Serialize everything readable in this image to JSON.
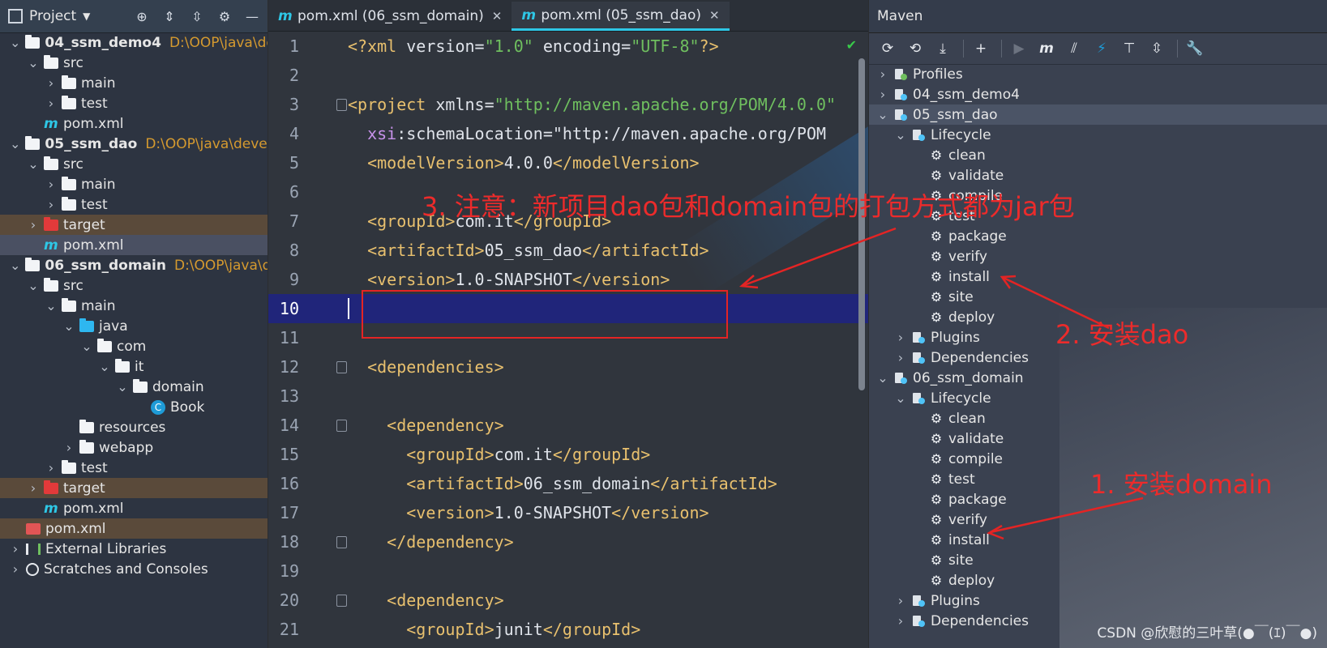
{
  "project_panel": {
    "title": "Project",
    "tree": [
      {
        "label": "04_ssm_demo4",
        "path": "D:\\OOP\\java\\deve",
        "indent": 0,
        "expanded": true,
        "icon": "module-folder-icon",
        "bold": true
      },
      {
        "label": "src",
        "indent": 1,
        "expanded": true,
        "icon": "folder-icon"
      },
      {
        "label": "main",
        "indent": 2,
        "expanded": false,
        "icon": "folder-icon"
      },
      {
        "label": "test",
        "indent": 2,
        "expanded": false,
        "icon": "folder-icon"
      },
      {
        "label": "pom.xml",
        "indent": 1,
        "icon": "maven-icon"
      },
      {
        "label": "05_ssm_dao",
        "path": "D:\\OOP\\java\\develop_",
        "indent": 0,
        "expanded": true,
        "icon": "module-folder-icon",
        "bold": true
      },
      {
        "label": "src",
        "indent": 1,
        "expanded": true,
        "icon": "folder-icon"
      },
      {
        "label": "main",
        "indent": 2,
        "expanded": false,
        "icon": "folder-icon"
      },
      {
        "label": "test",
        "indent": 2,
        "expanded": false,
        "icon": "folder-icon"
      },
      {
        "label": "target",
        "indent": 1,
        "expanded": false,
        "icon": "excluded-folder-icon",
        "state": "excluded"
      },
      {
        "label": "pom.xml",
        "indent": 1,
        "icon": "maven-icon",
        "state": "selected"
      },
      {
        "label": "06_ssm_domain",
        "path": "D:\\OOP\\java\\deve",
        "indent": 0,
        "expanded": true,
        "icon": "module-folder-icon",
        "bold": true
      },
      {
        "label": "src",
        "indent": 1,
        "expanded": true,
        "icon": "folder-icon"
      },
      {
        "label": "main",
        "indent": 2,
        "expanded": true,
        "icon": "folder-icon"
      },
      {
        "label": "java",
        "indent": 3,
        "expanded": true,
        "icon": "source-folder-icon"
      },
      {
        "label": "com",
        "indent": 4,
        "expanded": true,
        "icon": "package-icon"
      },
      {
        "label": "it",
        "indent": 5,
        "expanded": true,
        "icon": "package-icon"
      },
      {
        "label": "domain",
        "indent": 6,
        "expanded": true,
        "icon": "package-icon"
      },
      {
        "label": "Book",
        "indent": 7,
        "icon": "class-icon"
      },
      {
        "label": "resources",
        "indent": 3,
        "icon": "resources-folder-icon"
      },
      {
        "label": "webapp",
        "indent": 3,
        "expanded": false,
        "icon": "web-folder-icon"
      },
      {
        "label": "test",
        "indent": 2,
        "expanded": false,
        "icon": "folder-icon"
      },
      {
        "label": "target",
        "indent": 1,
        "expanded": false,
        "icon": "excluded-folder-icon",
        "state": "excluded"
      },
      {
        "label": "pom.xml",
        "indent": 1,
        "icon": "maven-icon"
      },
      {
        "label": "pom.xml",
        "indent": 0,
        "icon": "xml-file-icon",
        "state": "excluded"
      },
      {
        "label": "External Libraries",
        "indent": 0,
        "expanded": false,
        "icon": "libraries-icon"
      },
      {
        "label": "Scratches and Consoles",
        "indent": 0,
        "expanded": false,
        "icon": "scratches-icon"
      }
    ]
  },
  "editor": {
    "tabs": [
      {
        "label": "pom.xml (06_ssm_domain)",
        "active": false
      },
      {
        "label": "pom.xml (05_ssm_dao)",
        "active": true
      }
    ],
    "current_line": 10,
    "lines": [
      {
        "n": "1",
        "text": "<?xml version=\"1.0\" encoding=\"UTF-8\"?>"
      },
      {
        "n": "2",
        "text": ""
      },
      {
        "n": "3",
        "text": "<project xmlns=\"http://maven.apache.org/POM/4.0.0\"",
        "fold": true
      },
      {
        "n": "4",
        "text": "  xsi:schemaLocation=\"http://maven.apache.org/POM"
      },
      {
        "n": "5",
        "text": "  <modelVersion>4.0.0</modelVersion>"
      },
      {
        "n": "6",
        "text": ""
      },
      {
        "n": "7",
        "text": "  <groupId>com.it</groupId>"
      },
      {
        "n": "8",
        "text": "  <artifactId>05_ssm_dao</artifactId>"
      },
      {
        "n": "9",
        "text": "  <version>1.0-SNAPSHOT</version>"
      },
      {
        "n": "10",
        "text": ""
      },
      {
        "n": "11",
        "text": ""
      },
      {
        "n": "12",
        "text": "  <dependencies>",
        "fold": true
      },
      {
        "n": "13",
        "text": ""
      },
      {
        "n": "14",
        "text": "    <dependency>",
        "fold": true
      },
      {
        "n": "15",
        "text": "      <groupId>com.it</groupId>"
      },
      {
        "n": "16",
        "text": "      <artifactId>06_ssm_domain</artifactId>"
      },
      {
        "n": "17",
        "text": "      <version>1.0-SNAPSHOT</version>"
      },
      {
        "n": "18",
        "text": "    </dependency>",
        "fold": true
      },
      {
        "n": "19",
        "text": ""
      },
      {
        "n": "20",
        "text": "    <dependency>",
        "fold": true
      },
      {
        "n": "21",
        "text": "      <groupId>junit</groupId>"
      }
    ]
  },
  "maven_panel": {
    "title": "Maven",
    "toolbar": [
      "reload-icon",
      "generate-sources-icon",
      "download-icon",
      "add-icon",
      "run-icon",
      "maven-goal-icon",
      "toggle-offline-icon",
      "skip-tests-icon",
      "show-dependencies-icon",
      "collapse-all-icon",
      "settings-wrench-icon"
    ],
    "tree": [
      {
        "label": "Profiles",
        "indent": 0,
        "expanded": false,
        "icon": "profiles-icon"
      },
      {
        "label": "04_ssm_demo4",
        "indent": 0,
        "expanded": false,
        "icon": "maven-module-icon"
      },
      {
        "label": "05_ssm_dao",
        "indent": 0,
        "expanded": true,
        "icon": "maven-module-icon",
        "state": "selected"
      },
      {
        "label": "Lifecycle",
        "indent": 1,
        "expanded": true,
        "icon": "lifecycle-icon"
      },
      {
        "label": "clean",
        "indent": 2,
        "icon": "gear-icon"
      },
      {
        "label": "validate",
        "indent": 2,
        "icon": "gear-icon"
      },
      {
        "label": "compile",
        "indent": 2,
        "icon": "gear-icon"
      },
      {
        "label": "test",
        "indent": 2,
        "icon": "gear-icon"
      },
      {
        "label": "package",
        "indent": 2,
        "icon": "gear-icon"
      },
      {
        "label": "verify",
        "indent": 2,
        "icon": "gear-icon"
      },
      {
        "label": "install",
        "indent": 2,
        "icon": "gear-icon"
      },
      {
        "label": "site",
        "indent": 2,
        "icon": "gear-icon"
      },
      {
        "label": "deploy",
        "indent": 2,
        "icon": "gear-icon"
      },
      {
        "label": "Plugins",
        "indent": 1,
        "expanded": false,
        "icon": "plugins-icon"
      },
      {
        "label": "Dependencies",
        "indent": 1,
        "expanded": false,
        "icon": "dependencies-icon"
      },
      {
        "label": "06_ssm_domain",
        "indent": 0,
        "expanded": true,
        "icon": "maven-module-icon"
      },
      {
        "label": "Lifecycle",
        "indent": 1,
        "expanded": true,
        "icon": "lifecycle-icon"
      },
      {
        "label": "clean",
        "indent": 2,
        "icon": "gear-icon"
      },
      {
        "label": "validate",
        "indent": 2,
        "icon": "gear-icon"
      },
      {
        "label": "compile",
        "indent": 2,
        "icon": "gear-icon"
      },
      {
        "label": "test",
        "indent": 2,
        "icon": "gear-icon"
      },
      {
        "label": "package",
        "indent": 2,
        "icon": "gear-icon"
      },
      {
        "label": "verify",
        "indent": 2,
        "icon": "gear-icon"
      },
      {
        "label": "install",
        "indent": 2,
        "icon": "gear-icon"
      },
      {
        "label": "site",
        "indent": 2,
        "icon": "gear-icon"
      },
      {
        "label": "deploy",
        "indent": 2,
        "icon": "gear-icon"
      },
      {
        "label": "Plugins",
        "indent": 1,
        "expanded": false,
        "icon": "plugins-icon"
      },
      {
        "label": "Dependencies",
        "indent": 1,
        "expanded": false,
        "icon": "dependencies-icon"
      }
    ]
  },
  "annotations": {
    "note3": "3. 注意：新项目dao包和domain包的打包方式都为jar包",
    "note2": "2. 安装dao",
    "note1": "1. 安装domain",
    "color": "#ec2b2b"
  },
  "watermark": "CSDN @欣慰的三叶草(●￣(ｴ)￣●)",
  "colors": {
    "accent": "#2ec7e6",
    "current_line": "#20257a",
    "tag": "#e8c06e",
    "string": "#6fbf5f"
  }
}
